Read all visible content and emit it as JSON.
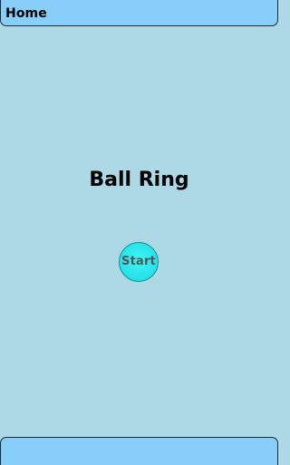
{
  "header": {
    "title": "Home"
  },
  "main": {
    "game_title": "Ball Ring",
    "start_button_label": "Start"
  },
  "colors": {
    "background": "#add8e6",
    "bar": "#87cefa",
    "start_button": "#28e3e8"
  }
}
